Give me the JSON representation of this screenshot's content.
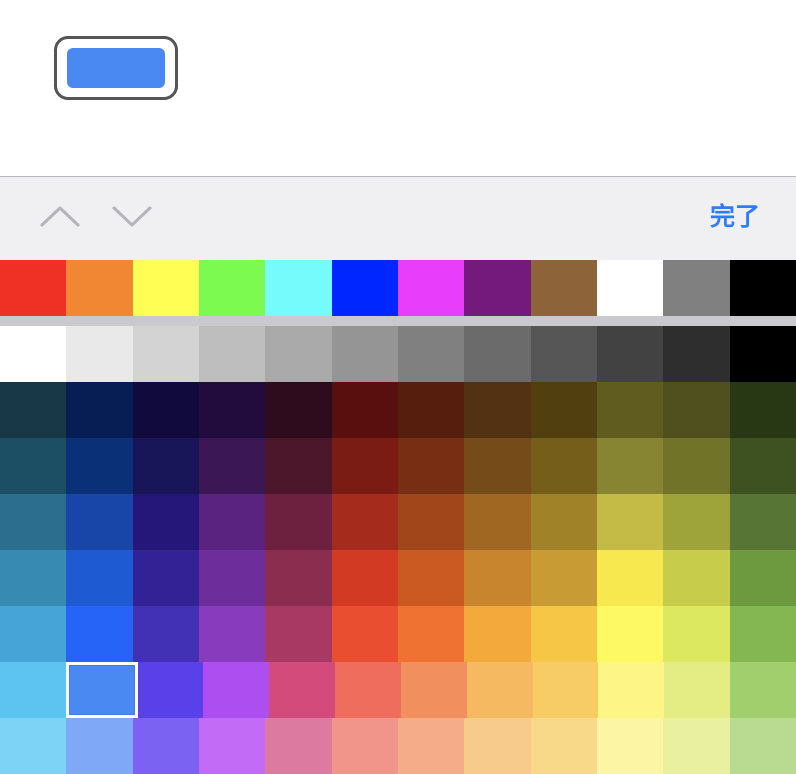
{
  "color_button": {
    "selected_color": "#4a88f2"
  },
  "toolbar": {
    "up_icon": "chevron-up-icon",
    "down_icon": "chevron-down-icon",
    "done_label": "完了",
    "done_color": "#2f7cf6"
  },
  "palette": {
    "selected": {
      "row": 6,
      "col": 1
    },
    "preset_row": [
      "#ee3124",
      "#f18633",
      "#fefe55",
      "#7dfa4f",
      "#76fbfd",
      "#0026ff",
      "#e83dfb",
      "#741a7c",
      "#8d6339",
      "#ffffff",
      "#808080",
      "#000000"
    ],
    "grid": [
      [
        "#ffffff",
        "#e9e9e9",
        "#d3d3d3",
        "#bebebe",
        "#aaaaaa",
        "#959595",
        "#808080",
        "#6b6b6b",
        "#565656",
        "#424242",
        "#2e2e2e",
        "#000000"
      ],
      [
        "#183848",
        "#071e55",
        "#100b3c",
        "#220c3d",
        "#2f0c1d",
        "#590f0e",
        "#561e0c",
        "#533213",
        "#523f10",
        "#605c20",
        "#4f501d",
        "#293814"
      ],
      [
        "#1d4f64",
        "#0a3078",
        "#181558",
        "#3b1855",
        "#4c162b",
        "#7a1c13",
        "#772e12",
        "#754b19",
        "#755d1a",
        "#878432",
        "#717329",
        "#3e5121"
      ],
      [
        "#2c6e8e",
        "#1846a8",
        "#25167a",
        "#5a2380",
        "#6e213e",
        "#a52b1c",
        "#a1461a",
        "#9f6722",
        "#a08229",
        "#c4bb46",
        "#9ea43a",
        "#577635"
      ],
      [
        "#378bb2",
        "#1e5bd3",
        "#322296",
        "#6d2e9b",
        "#8b2d4f",
        "#d23a23",
        "#ca5a22",
        "#c8852e",
        "#c99b34",
        "#f6e84e",
        "#c7cd4b",
        "#6d993f"
      ],
      [
        "#46a4d7",
        "#2664f7",
        "#4331b5",
        "#883bbc",
        "#a83963",
        "#ea4e30",
        "#f07232",
        "#f4a93d",
        "#f6c746",
        "#fdf964",
        "#dce860",
        "#84b751"
      ],
      [
        "#5dc4f2",
        "#4a88f2",
        "#5940e8",
        "#ac4ef0",
        "#d34b7a",
        "#ee6d5d",
        "#f28f5f",
        "#f5b962",
        "#f7cc66",
        "#fdf586",
        "#e4ed83",
        "#a2cf6e"
      ],
      [
        "#7dd3f6",
        "#7fa8f7",
        "#7c62f2",
        "#c16bf7",
        "#dd7aa0",
        "#f1948a",
        "#f4ad88",
        "#f6cb8c",
        "#f8d98a",
        "#fcf6a4",
        "#e9f09f",
        "#b9da91"
      ]
    ]
  }
}
